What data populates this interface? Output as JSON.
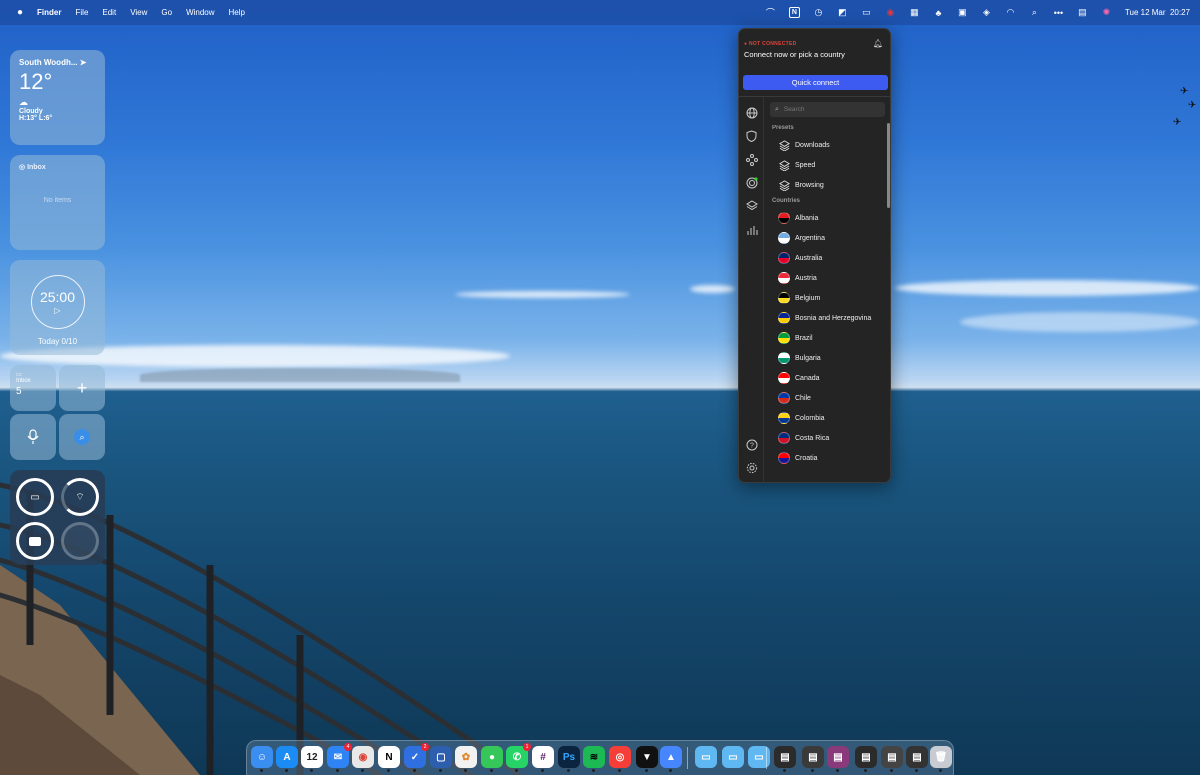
{
  "menubar": {
    "apple_icon": "apple-icon",
    "app_name": "Finder",
    "menus": [
      "File",
      "Edit",
      "View",
      "Go",
      "Window",
      "Help"
    ],
    "status_icons": [
      "vpn-icon",
      "notion-icon",
      "time-machine-icon",
      "display-icon",
      "battery-icon",
      "record-icon",
      "menu-icon",
      "palm-icon",
      "monitor-icon",
      "layers-icon",
      "wifi-icon",
      "search-icon",
      "more-icon",
      "control-center-icon",
      "siri-icon"
    ],
    "notion_letter": "N",
    "clock": "Tue 12 Mar  20:27"
  },
  "widgets": {
    "weather": {
      "city": "South Woodh...",
      "temp": "12°",
      "condition": "Cloudy",
      "high_low": "H:13° L:6°"
    },
    "inbox": {
      "title": "Inbox",
      "empty": "No items"
    },
    "timer": {
      "time": "25:00",
      "play": "▷",
      "today": "Today 0/10"
    },
    "quick": {
      "label": "Inbox",
      "count": "5",
      "plus": "+"
    },
    "batteries": [
      {
        "device": "laptop",
        "level": 1.0
      },
      {
        "device": "airpods",
        "level": 0.8
      },
      {
        "device": "case",
        "level": 1.0
      },
      {
        "device": "empty",
        "level": 0.0
      }
    ]
  },
  "vpn": {
    "status": "NOT CONNECTED",
    "prompt": "Connect now or pick a country",
    "quick_connect": "Quick connect",
    "search_placeholder": "Search",
    "presets_label": "Presets",
    "presets": [
      "Downloads",
      "Speed",
      "Browsing"
    ],
    "countries_label": "Countries",
    "countries": [
      {
        "name": "Albania",
        "colors": [
          "#e41e20",
          "#000000"
        ]
      },
      {
        "name": "Argentina",
        "colors": [
          "#74acdf",
          "#ffffff"
        ]
      },
      {
        "name": "Australia",
        "colors": [
          "#012169",
          "#e4002b"
        ]
      },
      {
        "name": "Austria",
        "colors": [
          "#ed2939",
          "#ffffff"
        ]
      },
      {
        "name": "Belgium",
        "colors": [
          "#000000",
          "#fdda24"
        ]
      },
      {
        "name": "Bosnia and Herzegovina",
        "colors": [
          "#002395",
          "#fecb00"
        ]
      },
      {
        "name": "Brazil",
        "colors": [
          "#009c3b",
          "#ffdf00"
        ]
      },
      {
        "name": "Bulgaria",
        "colors": [
          "#ffffff",
          "#00966e"
        ]
      },
      {
        "name": "Canada",
        "colors": [
          "#ff0000",
          "#ffffff"
        ]
      },
      {
        "name": "Chile",
        "colors": [
          "#0039a6",
          "#d52b1e"
        ]
      },
      {
        "name": "Colombia",
        "colors": [
          "#fcd116",
          "#003893"
        ]
      },
      {
        "name": "Costa Rica",
        "colors": [
          "#002b7f",
          "#ce1126"
        ]
      },
      {
        "name": "Croatia",
        "colors": [
          "#ff0000",
          "#171796"
        ]
      }
    ]
  },
  "dock": {
    "items": [
      {
        "name": "finder",
        "color": "#3a8ef0",
        "glyph": "☺"
      },
      {
        "name": "app-store",
        "color": "#1c8cf5",
        "glyph": "A"
      },
      {
        "name": "calendar",
        "color": "#ffffff",
        "glyph": "12",
        "text_color": "#222222"
      },
      {
        "name": "mail",
        "color": "#2e83f5",
        "glyph": "✉",
        "badge": "4"
      },
      {
        "name": "chrome",
        "color": "#e8e8e8",
        "glyph": "◉",
        "text_color": "#db4437"
      },
      {
        "name": "notion",
        "color": "#ffffff",
        "glyph": "N",
        "text_color": "#000000"
      },
      {
        "name": "tasks",
        "color": "#2f6fe0",
        "glyph": "✓",
        "badge": "2"
      },
      {
        "name": "screens",
        "color": "#2d5fae",
        "glyph": "▢"
      },
      {
        "name": "photos",
        "color": "#f2f2f2",
        "glyph": "✿",
        "text_color": "#e2852b"
      },
      {
        "name": "messages",
        "color": "#35c759",
        "glyph": "●"
      },
      {
        "name": "whatsapp",
        "color": "#25d366",
        "glyph": "✆",
        "badge": "1"
      },
      {
        "name": "slack",
        "color": "#ffffff",
        "glyph": "#",
        "text_color": "#611f69"
      },
      {
        "name": "photoshop",
        "color": "#0b2540",
        "glyph": "Ps",
        "text_color": "#31a8ff"
      },
      {
        "name": "spotify",
        "color": "#1db954",
        "glyph": "≋",
        "text_color": "#000000"
      },
      {
        "name": "pocketcasts",
        "color": "#f43e37",
        "glyph": "◎"
      },
      {
        "name": "folder-app",
        "color": "#111111",
        "glyph": "▼"
      },
      {
        "name": "nordvpn",
        "color": "#4687ff",
        "glyph": "▲"
      },
      {
        "name": "folder-applications",
        "color": "#5fb8f2",
        "glyph": "▭"
      },
      {
        "name": "folder-documents",
        "color": "#5fb8f2",
        "glyph": "▭"
      },
      {
        "name": "folder-downloads",
        "color": "#5fb8f2",
        "glyph": "▭"
      },
      {
        "name": "minimized-1",
        "color": "#2b2b2b",
        "glyph": "▤"
      },
      {
        "name": "minimized-2",
        "color": "#3a3a3a",
        "glyph": "▤"
      },
      {
        "name": "minimized-3",
        "color": "#8a3a7a",
        "glyph": "▤"
      },
      {
        "name": "minimized-4",
        "color": "#2b2b2b",
        "glyph": "▤"
      },
      {
        "name": "minimized-5",
        "color": "#444444",
        "glyph": "▤"
      },
      {
        "name": "minimized-6",
        "color": "#333333",
        "glyph": "▤"
      },
      {
        "name": "trash",
        "color": "#c8ccd2",
        "glyph": "🗑"
      }
    ]
  }
}
